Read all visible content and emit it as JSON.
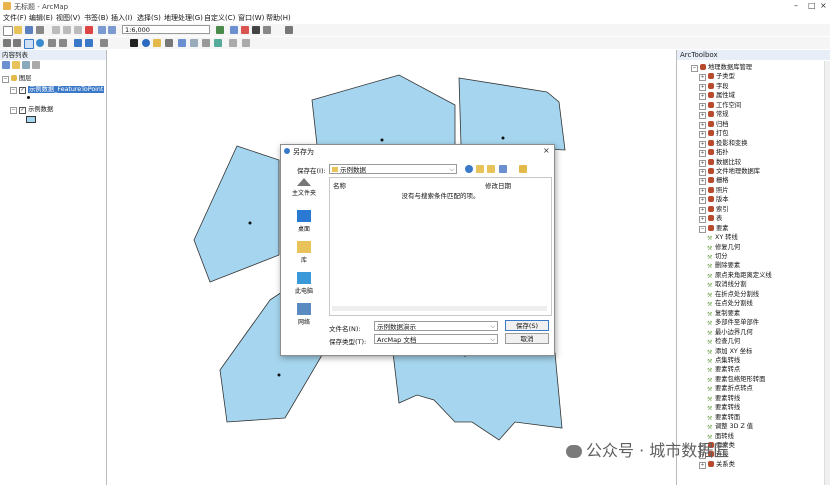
{
  "window": {
    "title": "无标题 - ArcMap"
  },
  "menu": [
    "文件(F)",
    "编辑(E)",
    "视图(V)",
    "书签(B)",
    "插入(I)",
    "选择(S)",
    "地理处理(G)",
    "自定义(C)",
    "窗口(W)",
    "帮助(H)"
  ],
  "toolbar": {
    "scale": "1:6,000"
  },
  "toc": {
    "title": "内容列表",
    "root_label": "图层",
    "layers": [
      {
        "name": "示例数据_FeatureToPoint",
        "checked": true,
        "selected": true
      },
      {
        "name": "示例数据",
        "checked": true,
        "selected": false
      }
    ]
  },
  "toolbox": {
    "title": "ArcToolbox",
    "items": [
      {
        "label": "地理数据库管理",
        "kind": "box",
        "expanded": true,
        "depth": 0
      },
      {
        "label": "子类型",
        "kind": "box",
        "expanded": false,
        "depth": 1
      },
      {
        "label": "字段",
        "kind": "box",
        "expanded": false,
        "depth": 1
      },
      {
        "label": "属性域",
        "kind": "box",
        "expanded": false,
        "depth": 1
      },
      {
        "label": "工作空间",
        "kind": "box",
        "expanded": false,
        "depth": 1
      },
      {
        "label": "常规",
        "kind": "box",
        "expanded": false,
        "depth": 1
      },
      {
        "label": "归档",
        "kind": "box",
        "expanded": false,
        "depth": 1
      },
      {
        "label": "打包",
        "kind": "box",
        "expanded": false,
        "depth": 1
      },
      {
        "label": "投影和变换",
        "kind": "box",
        "expanded": false,
        "depth": 1
      },
      {
        "label": "拓扑",
        "kind": "box",
        "expanded": false,
        "depth": 1
      },
      {
        "label": "数据比较",
        "kind": "box",
        "expanded": false,
        "depth": 1
      },
      {
        "label": "文件地理数据库",
        "kind": "box",
        "expanded": false,
        "depth": 1
      },
      {
        "label": "栅格",
        "kind": "box",
        "expanded": false,
        "depth": 1
      },
      {
        "label": "照片",
        "kind": "box",
        "expanded": false,
        "depth": 1
      },
      {
        "label": "版本",
        "kind": "box",
        "expanded": false,
        "depth": 1
      },
      {
        "label": "索引",
        "kind": "box",
        "expanded": false,
        "depth": 1
      },
      {
        "label": "表",
        "kind": "box",
        "expanded": false,
        "depth": 1
      },
      {
        "label": "要素",
        "kind": "box",
        "expanded": true,
        "depth": 1
      },
      {
        "label": "XY 转线",
        "kind": "tool",
        "depth": 2
      },
      {
        "label": "修复几何",
        "kind": "tool",
        "depth": 2
      },
      {
        "label": "切分",
        "kind": "tool",
        "depth": 2
      },
      {
        "label": "删除要素",
        "kind": "tool",
        "depth": 2
      },
      {
        "label": "原点来角距离定义线",
        "kind": "tool",
        "depth": 2
      },
      {
        "label": "取消线分割",
        "kind": "tool",
        "depth": 2
      },
      {
        "label": "在折点处分割线",
        "kind": "tool",
        "depth": 2
      },
      {
        "label": "在点处分割线",
        "kind": "tool",
        "depth": 2
      },
      {
        "label": "复制要素",
        "kind": "tool",
        "depth": 2
      },
      {
        "label": "多部件至单部件",
        "kind": "tool",
        "depth": 2
      },
      {
        "label": "最小边界几何",
        "kind": "tool",
        "depth": 2
      },
      {
        "label": "检查几何",
        "kind": "tool",
        "depth": 2
      },
      {
        "label": "添加 XY 坐标",
        "kind": "tool",
        "depth": 2
      },
      {
        "label": "点集转线",
        "kind": "tool",
        "depth": 2
      },
      {
        "label": "要素转点",
        "kind": "tool",
        "depth": 2
      },
      {
        "label": "要素包络矩形转面",
        "kind": "tool",
        "depth": 2
      },
      {
        "label": "要素折点转点",
        "kind": "tool",
        "depth": 2
      },
      {
        "label": "要素转线",
        "kind": "tool",
        "depth": 2
      },
      {
        "label": "要素转线",
        "kind": "tool",
        "depth": 2
      },
      {
        "label": "要素转面",
        "kind": "tool",
        "depth": 2
      },
      {
        "label": "调整 3D Z 值",
        "kind": "tool",
        "depth": 2
      },
      {
        "label": "面转线",
        "kind": "tool",
        "depth": 2
      },
      {
        "label": "要素类",
        "kind": "box",
        "expanded": false,
        "depth": 1
      },
      {
        "label": "连接",
        "kind": "box",
        "expanded": false,
        "depth": 1
      },
      {
        "label": "关系类",
        "kind": "box",
        "expanded": false,
        "depth": 1
      }
    ]
  },
  "dialog": {
    "title": "另存为",
    "look_in_label": "保存在(I):",
    "look_in_value": "示例数据",
    "col_name": "名称",
    "col_date": "修改日期",
    "empty_message": "没有与搜索条件匹配的项。",
    "places": [
      "主文件夹",
      "桌面",
      "库",
      "此电脑",
      "网络"
    ],
    "filename_label": "文件名(N):",
    "filename_value": "示例数据演示",
    "filetype_label": "保存类型(T):",
    "filetype_value": "ArcMap 文档",
    "save_button": "保存(S)",
    "cancel_button": "取消"
  },
  "watermark": "公众号 · 城市数据匠",
  "colors": {
    "polygon_fill": "#a6d6ef",
    "polygon_stroke": "#333333",
    "selection": "#3a78c8"
  }
}
